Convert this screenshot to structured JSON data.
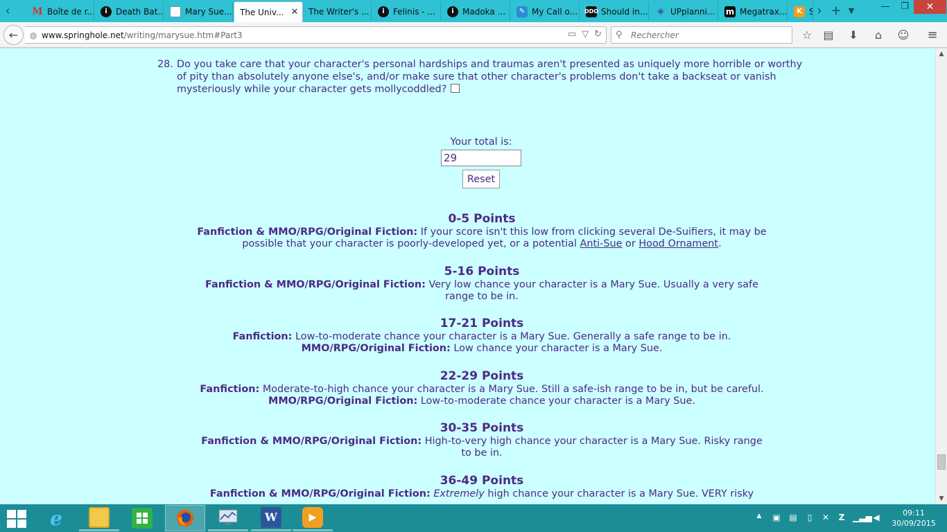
{
  "tabs": [
    {
      "title": "Boîte de r...",
      "icon": "gmail-icon"
    },
    {
      "title": "Death Bat...",
      "icon": "info-circle-icon"
    },
    {
      "title": "Mary Sue...",
      "icon": "page-icon"
    },
    {
      "title": "The Univ...",
      "icon": "page-icon",
      "active": true
    },
    {
      "title": "The Writer's ...",
      "icon": "none"
    },
    {
      "title": "Felinis - ...",
      "icon": "info-circle-icon"
    },
    {
      "title": "Madoka ...",
      "icon": "info-circle-icon"
    },
    {
      "title": "My Call o...",
      "icon": "message-icon"
    },
    {
      "title": "Should in...",
      "icon": "ddo-icon"
    },
    {
      "title": "UPplanni...",
      "icon": "up-icon"
    },
    {
      "title": "Megatrax...",
      "icon": "m-icon"
    },
    {
      "title": "S",
      "icon": "k-icon"
    }
  ],
  "address": {
    "host": "www.springhole.net",
    "path": "/writing/marysue.htm#Part3"
  },
  "search": {
    "placeholder": "Rechercher"
  },
  "question": {
    "number": "28.",
    "text": "Do you take care that your character's personal hardships and traumas aren't presented as uniquely more horrible or worthy of pity than absolutely anyone else's, and/or make sure that other character's problems don't take a backseat or vanish mysteriously while your character gets mollycoddled?"
  },
  "total": {
    "label": "Your total is:",
    "value": "29",
    "reset_label": "Reset"
  },
  "ranges": [
    {
      "heading": "0-5 Points",
      "lines": [
        {
          "label": "Fanfiction & MMO/RPG/Original Fiction:",
          "pre": "If your score isn't this low from clicking several De-Suifiers, it may be possible that your character is poorly-developed yet, or a potential",
          "link1": "Anti-Sue",
          "mid": "or",
          "link2": "Hood Ornament",
          "post": "."
        }
      ]
    },
    {
      "heading": "5-16 Points",
      "lines": [
        {
          "label": "Fanfiction & MMO/RPG/Original Fiction:",
          "text": "Very low chance your character is a Mary Sue. Usually a very safe range to be in."
        }
      ]
    },
    {
      "heading": "17-21 Points",
      "lines": [
        {
          "label": "Fanfiction:",
          "text": "Low-to-moderate chance your character is a Mary Sue. Generally a safe range to be in."
        },
        {
          "label": "MMO/RPG/Original Fiction:",
          "text": "Low chance your character is a Mary Sue."
        }
      ]
    },
    {
      "heading": "22-29 Points",
      "lines": [
        {
          "label": "Fanfiction:",
          "text": "Moderate-to-high chance your character is a Mary Sue. Still a safe-ish range to be in, but be careful."
        },
        {
          "label": "MMO/RPG/Original Fiction:",
          "text": "Low-to-moderate chance your character is a Mary Sue."
        }
      ]
    },
    {
      "heading": "30-35 Points",
      "lines": [
        {
          "label": "Fanfiction & MMO/RPG/Original Fiction:",
          "text": "High-to-very high chance your character is a Mary Sue. Risky range to be in."
        }
      ]
    },
    {
      "heading": "36-49 Points",
      "lines": [
        {
          "label": "Fanfiction & MMO/RPG/Original Fiction:",
          "em": "Extremely",
          "text": "high chance your character is a Mary Sue. VERY risky"
        }
      ]
    }
  ],
  "taskbar": {
    "apps": [
      {
        "name": "internet-explorer",
        "glyph": "e"
      },
      {
        "name": "file-explorer",
        "glyph": ""
      },
      {
        "name": "store",
        "glyph": ""
      },
      {
        "name": "firefox",
        "glyph": ""
      },
      {
        "name": "monitor",
        "glyph": ""
      },
      {
        "name": "word",
        "glyph": "W"
      },
      {
        "name": "media-player",
        "glyph": "▶"
      }
    ],
    "clock": {
      "time": "09:11",
      "date": "30/09/2015"
    }
  },
  "colors": {
    "tabstrip": "#2ec2d4",
    "page_background": "#ccffff",
    "page_text": "#4c2a85",
    "taskbar": "#1b8d96"
  }
}
